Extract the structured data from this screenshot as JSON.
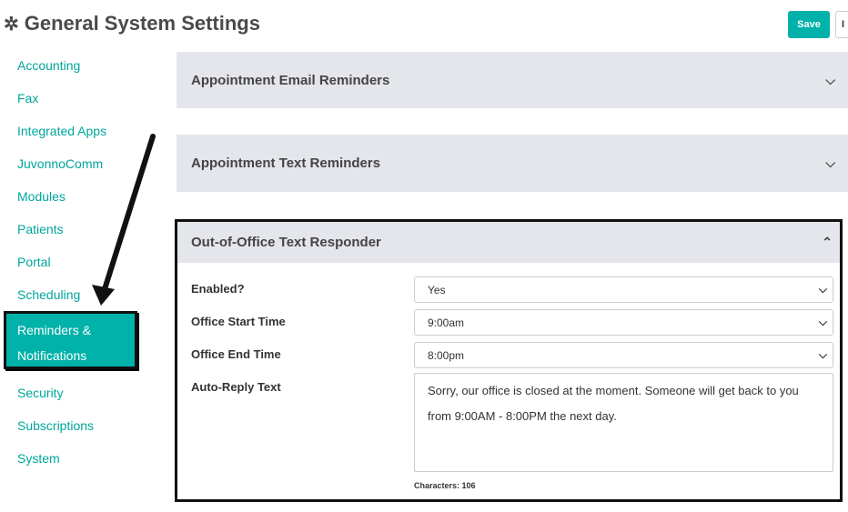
{
  "header": {
    "title": "General System Settings",
    "gear_icon": "gear-icon",
    "save_label": "Save",
    "extra_button_label": "I"
  },
  "sidebar": {
    "items": [
      {
        "label": "Accounting"
      },
      {
        "label": "Fax"
      },
      {
        "label": "Integrated Apps"
      },
      {
        "label": "JuvonnoComm"
      },
      {
        "label": "Modules"
      },
      {
        "label": "Patients"
      },
      {
        "label": "Portal"
      },
      {
        "label": "Scheduling"
      },
      {
        "label": "Reminders & Notifications",
        "active": true
      },
      {
        "label": "Security"
      },
      {
        "label": "Subscriptions"
      },
      {
        "label": "System"
      }
    ]
  },
  "panels": {
    "email": {
      "title": "Appointment Email Reminders",
      "state": "collapsed"
    },
    "text": {
      "title": "Appointment Text Reminders",
      "state": "collapsed"
    },
    "ooo": {
      "title": "Out-of-Office Text Responder",
      "state": "expanded",
      "enabled_label": "Enabled?",
      "enabled_value": "Yes",
      "start_label": "Office Start Time",
      "start_value": "9:00am",
      "end_label": "Office End Time",
      "end_value": "8:00pm",
      "reply_label": "Auto-Reply Text",
      "reply_value": "Sorry, our office is closed at the moment. Someone will get back to you from 9:00AM - 8:00PM the next day.",
      "char_count": "Characters: 106"
    }
  },
  "colors": {
    "accent": "#00b2a9",
    "link": "#00a69c",
    "panel_bg": "#e4e6eb",
    "annotation": "#111111"
  }
}
